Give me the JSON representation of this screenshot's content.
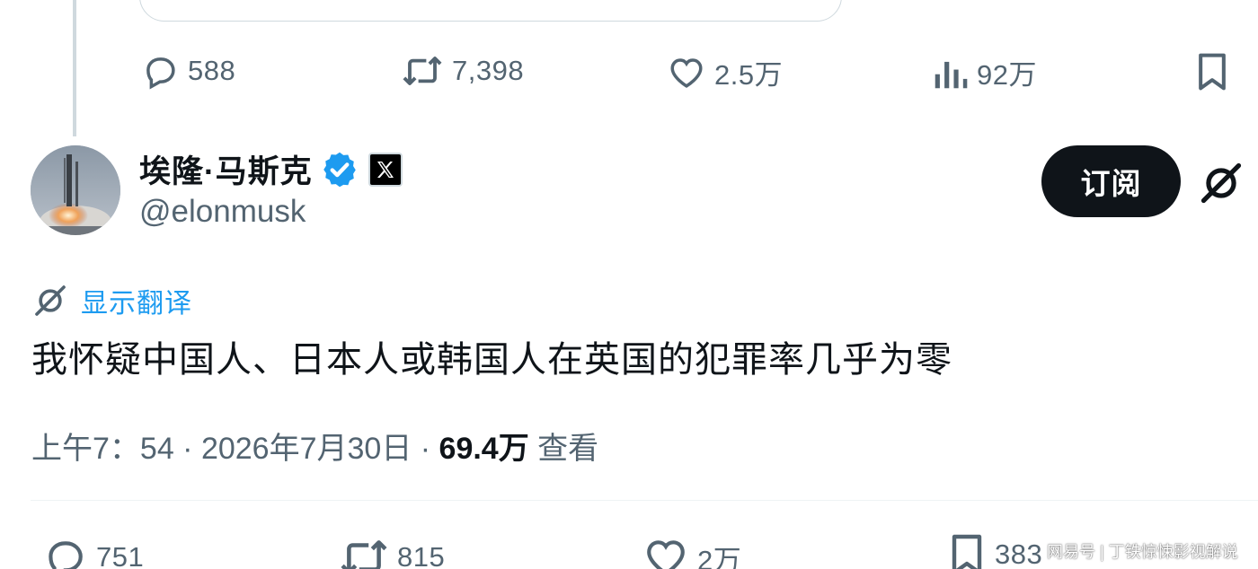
{
  "previous_tweet": {
    "actions": {
      "replies": "588",
      "retweets": "7,398",
      "likes": "2.5万",
      "views": "92万"
    },
    "icons": [
      "reply-icon",
      "retweet-icon",
      "like-icon",
      "views-icon",
      "bookmark-icon"
    ]
  },
  "tweet": {
    "author": {
      "display_name": "埃隆·马斯克",
      "handle": "@elonmusk",
      "verified_color": "#1d9bf0"
    },
    "subscribe_label": "订阅",
    "translate_label": "显示翻译",
    "text": "我怀疑中国人、日本人或韩国人在英国的犯罪率几乎为零",
    "meta": {
      "time": "上午7：54",
      "sep1": " · ",
      "date": "2026年7月30日",
      "sep2": " · ",
      "views_count": "69.4万",
      "views_label": " 查看"
    },
    "actions": {
      "replies": "751",
      "retweets": "815",
      "likes": "2万",
      "bookmarks": "383"
    }
  },
  "watermark": "网易号 | 丁铁惊悚影视解说",
  "colors": {
    "accent": "#1d9bf0",
    "text_primary": "#0f1419",
    "text_secondary": "#536471",
    "border": "#cfd9de"
  }
}
